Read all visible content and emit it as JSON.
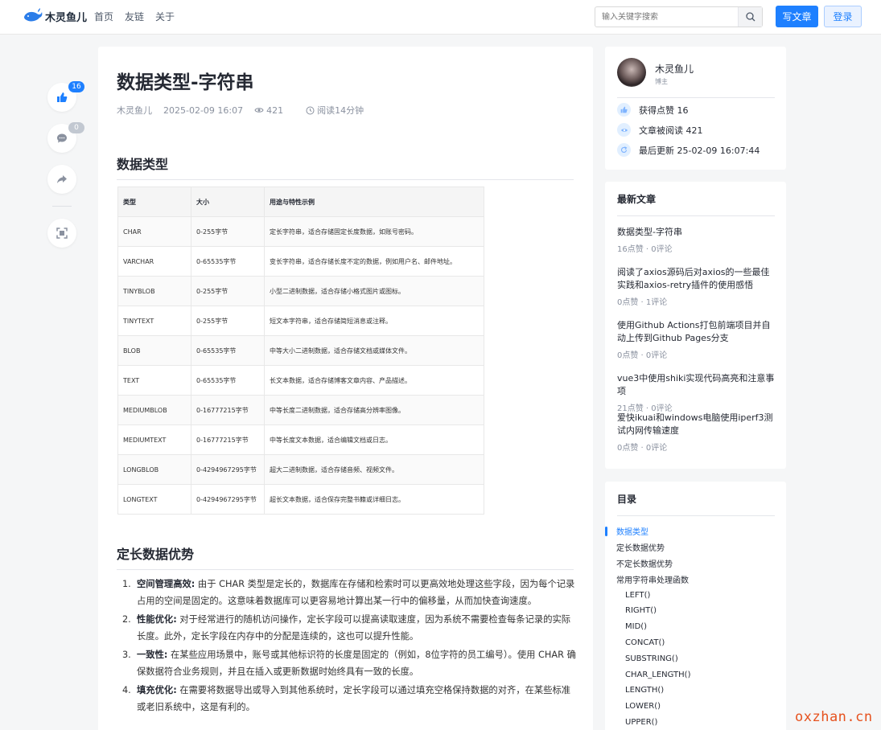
{
  "header": {
    "logo_text": "木灵鱼儿",
    "nav": [
      "首页",
      "友链",
      "关于"
    ],
    "search_placeholder": "输入关键字搜索",
    "write_label": "写文章",
    "login_label": "登录"
  },
  "side_actions": {
    "like_count": "16",
    "comment_count": "0"
  },
  "article": {
    "title": "数据类型-字符串",
    "author": "木灵鱼儿",
    "date": "2025-02-09 16:07",
    "views": "421",
    "read_time": "阅读14分钟",
    "section1": "数据类型",
    "table": {
      "headers": [
        "类型",
        "大小",
        "用途与特性示例"
      ],
      "rows": [
        [
          "CHAR",
          "0-255字节",
          "定长字符串，适合存储固定长度数据，如账号密码。"
        ],
        [
          "VARCHAR",
          "0-65535字节",
          "变长字符串，适合存储长度不定的数据，例如用户名、邮件地址。"
        ],
        [
          "TINYBLOB",
          "0-255字节",
          "小型二进制数据，适合存储小格式图片或图标。"
        ],
        [
          "TINYTEXT",
          "0-255字节",
          "短文本字符串，适合存储简短消息或注释。"
        ],
        [
          "BLOB",
          "0-65535字节",
          "中等大小二进制数据，适合存储文档或媒体文件。"
        ],
        [
          "TEXT",
          "0-65535字节",
          "长文本数据，适合存储博客文章内容、产品描述。"
        ],
        [
          "MEDIUMBLOB",
          "0-16777215字节",
          "中等长度二进制数据，适合存储高分辨率图像。"
        ],
        [
          "MEDIUMTEXT",
          "0-16777215字节",
          "中等长度文本数据，适合编辑文档或日志。"
        ],
        [
          "LONGBLOB",
          "0-4294967295字节",
          "超大二进制数据，适合存储音频、视频文件。"
        ],
        [
          "LONGTEXT",
          "0-4294967295字节",
          "超长文本数据，适合保存完整书籍或详细日志。"
        ]
      ]
    },
    "section2": "定长数据优势",
    "advantages": [
      {
        "num": "1.",
        "head": "空间管理高效:",
        "body": " 由于 CHAR 类型是定长的，数据库在存储和检索时可以更高效地处理这些字段，因为每个记录占用的空间是固定的。这意味着数据库可以更容易地计算出某一行中的偏移量，从而加快查询速度。"
      },
      {
        "num": "2.",
        "head": "性能优化:",
        "body": " 对于经常进行的随机访问操作，定长字段可以提高读取速度，因为系统不需要检查每条记录的实际长度。此外，定长字段在内存中的分配是连续的，这也可以提升性能。"
      },
      {
        "num": "3.",
        "head": "一致性:",
        "body": " 在某些应用场景中，账号或其他标识符的长度是固定的（例如，8位字符的员工编号）。使用 CHAR 确保数据符合业务规则，并且在插入或更新数据时始终具有一致的长度。"
      },
      {
        "num": "4.",
        "head": "填充优化:",
        "body": " 在需要将数据导出或导入到其他系统时，定长字段可以通过填充空格保持数据的对齐，在某些标准或老旧系统中，这是有利的。"
      }
    ]
  },
  "author_card": {
    "name": "木灵鱼儿",
    "role": "博主",
    "likes": "获得点赞 16",
    "reads": "文章被阅读 421",
    "updated": "最后更新 25-02-09 16:07:44"
  },
  "recent": {
    "title": "最新文章",
    "items": [
      {
        "title": "数据类型-字符串",
        "meta": "16点赞 · 0评论"
      },
      {
        "title": "阅读了axios源码后对axios的一些最佳实践和axios-retry插件的使用感悟",
        "meta": "0点赞 · 1评论"
      },
      {
        "title": "使用Github Actions打包前端项目并自动上传到Github Pages分支",
        "meta": "0点赞 · 0评论"
      },
      {
        "title": "vue3中使用shiki实现代码高亮和注意事项",
        "meta": "21点赞 · 0评论"
      },
      {
        "title": "爱快ikuai和windows电脑使用iperf3测试内网传输速度",
        "meta": "0点赞 · 0评论"
      }
    ]
  },
  "toc": {
    "title": "目录",
    "items": [
      {
        "label": "数据类型",
        "level": 1,
        "active": true
      },
      {
        "label": "定长数据优势",
        "level": 1
      },
      {
        "label": "不定长数据优势",
        "level": 1
      },
      {
        "label": "常用字符串处理函数",
        "level": 1
      },
      {
        "label": "LEFT()",
        "level": 2
      },
      {
        "label": "RIGHT()",
        "level": 2
      },
      {
        "label": "MID()",
        "level": 2
      },
      {
        "label": "CONCAT()",
        "level": 2
      },
      {
        "label": "SUBSTRING()",
        "level": 2
      },
      {
        "label": "CHAR_LENGTH()",
        "level": 2
      },
      {
        "label": "LENGTH()",
        "level": 2
      },
      {
        "label": "LOWER()",
        "level": 2
      },
      {
        "label": "UPPER()",
        "level": 2
      }
    ]
  },
  "watermark": "oxzhan.cn",
  "colors": {
    "accent": "#1e80ff",
    "watermark": "#e6521f"
  }
}
